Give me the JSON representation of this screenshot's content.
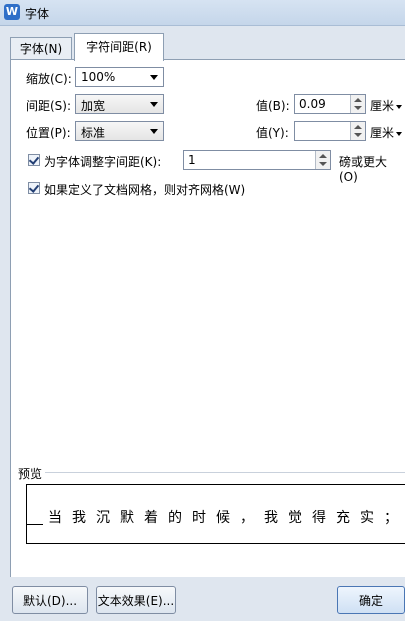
{
  "window": {
    "title": "字体",
    "app_icon": "W"
  },
  "tabs": [
    {
      "label": "字体(N)"
    },
    {
      "label": "字符间距(R)"
    }
  ],
  "fields": {
    "scale_label": "缩放(C):",
    "scale_value": "100%",
    "spacing_label": "间距(S):",
    "spacing_value": "加宽",
    "position_label": "位置(P):",
    "position_value": "标准",
    "spacing_amount_label": "值(B):",
    "spacing_amount_value": "0.09",
    "spacing_unit": "厘米",
    "position_amount_label": "值(Y):",
    "position_amount_value": "",
    "position_unit": "厘米"
  },
  "kerning": {
    "label": "为字体调整字间距(K):",
    "checked": true,
    "value": "1",
    "suffix": "磅或更大(O)"
  },
  "grid_snap": {
    "label": "如果定义了文档网格，则对齐网格(W)",
    "checked": true
  },
  "preview": {
    "label": "预览",
    "text": "当我沉默着的时候，我觉得充实；我将开"
  },
  "buttons": {
    "default": "默认(D)...",
    "text_effects": "文本效果(E)...",
    "ok": "确定"
  }
}
